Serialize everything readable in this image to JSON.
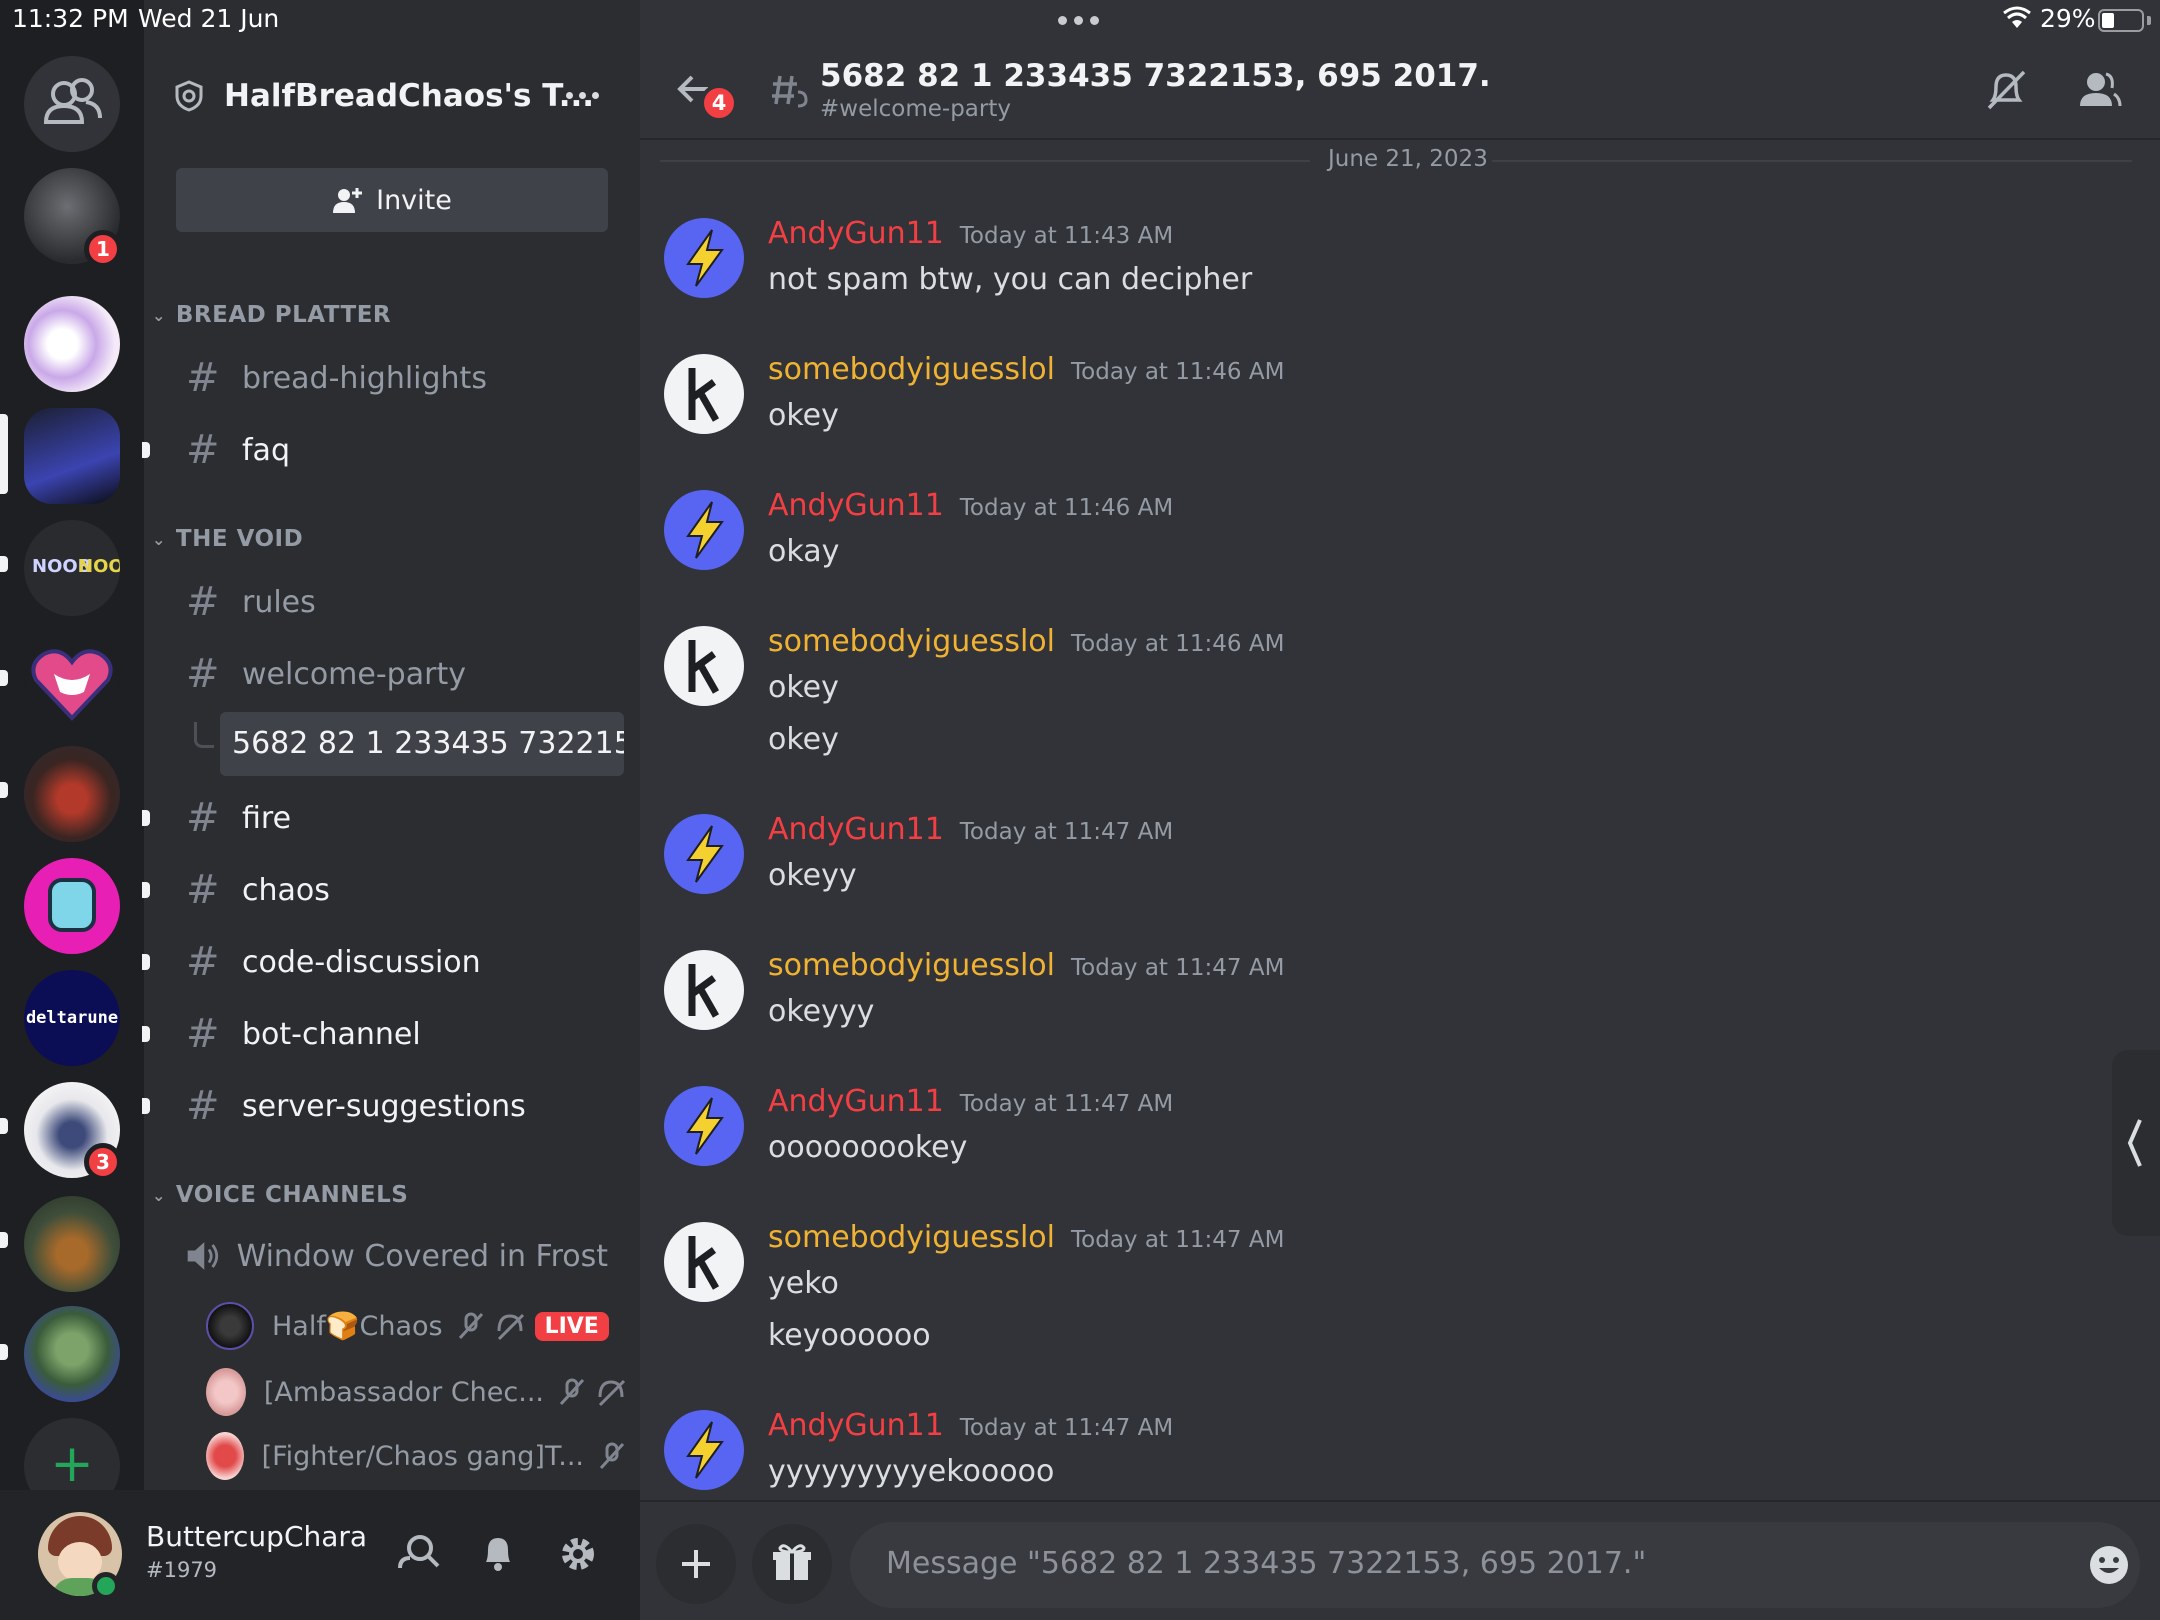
{
  "status_bar": {
    "time": "11:32 PM",
    "date": "Wed 21 Jun",
    "battery": "29%"
  },
  "rail": {
    "dm_badge": "1",
    "server_badge": "3",
    "noob_text": "NOOB",
    "deltarune_text": "deltarune"
  },
  "server": {
    "name": "HalfBreadChaos's T...",
    "invite_label": "Invite"
  },
  "categories": {
    "bread_platter": "BREAD PLATTER",
    "the_void": "THE VOID",
    "voice_channels": "VOICE CHANNELS"
  },
  "channels": {
    "bread_highlights": "bread-highlights",
    "faq": "faq",
    "rules": "rules",
    "welcome_party": "welcome-party",
    "active_thread": "5682 82 1 233435 732215...",
    "fire": "fire",
    "chaos": "chaos",
    "code_discussion": "code-discussion",
    "bot_channel": "bot-channel",
    "server_suggestions": "server-suggestions",
    "voice_window": "Window Covered in Frost"
  },
  "voice_users": [
    {
      "name": "Half🍞Chaos",
      "live": "LIVE"
    },
    {
      "name": "[Ambassador Chec..."
    },
    {
      "name": "[Fighter/Chaos gang]T..."
    }
  ],
  "user": {
    "name": "ButtercupChara",
    "tag": "#1979"
  },
  "chat": {
    "title": "5682 82 1 233435 7322153, 695 2017.",
    "subtitle": "#welcome-party",
    "back_badge": "4",
    "date_divider": "June 21, 2023"
  },
  "messages": [
    {
      "author": "AndyGun11",
      "time": "Today at 11:43 AM",
      "lines": [
        "not spam btw, you can decipher"
      ]
    },
    {
      "author": "somebodyiguesslol",
      "time": "Today at 11:46 AM",
      "lines": [
        "okey"
      ]
    },
    {
      "author": "AndyGun11",
      "time": "Today at 11:46 AM",
      "lines": [
        "okay"
      ]
    },
    {
      "author": "somebodyiguesslol",
      "time": "Today at 11:46 AM",
      "lines": [
        "okey",
        "okey"
      ]
    },
    {
      "author": "AndyGun11",
      "time": "Today at 11:47 AM",
      "lines": [
        "okeyy"
      ]
    },
    {
      "author": "somebodyiguesslol",
      "time": "Today at 11:47 AM",
      "lines": [
        "okeyyy"
      ]
    },
    {
      "author": "AndyGun11",
      "time": "Today at 11:47 AM",
      "lines": [
        "ooooooookey"
      ]
    },
    {
      "author": "somebodyiguesslol",
      "time": "Today at 11:47 AM",
      "lines": [
        "yeko",
        "keyoooooo"
      ]
    },
    {
      "author": "AndyGun11",
      "time": "Today at 11:47 AM",
      "lines": [
        "yyyyyyyyyekooooo"
      ]
    }
  ],
  "composer": {
    "placeholder": "Message \"5682 82 1 233435 7322153, 695 2017.\""
  },
  "colors": {
    "andy": "#f23f43",
    "somebody": "#f0b232",
    "accent": "#5865f2",
    "online": "#23a55a"
  }
}
